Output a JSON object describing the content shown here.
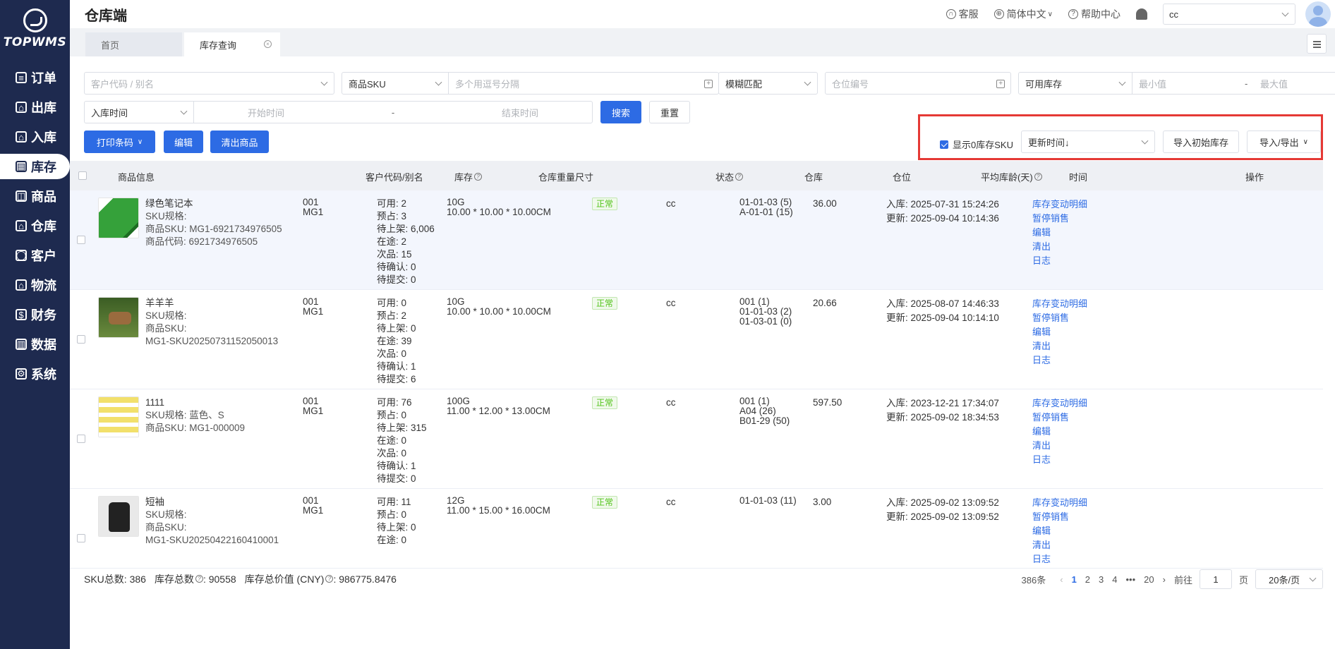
{
  "app": {
    "logo_text": "TOPWMS",
    "title": "仓库端"
  },
  "sidebar": {
    "items": [
      {
        "label": "订单",
        "icon": "list-icon"
      },
      {
        "label": "出库",
        "icon": "home-icon"
      },
      {
        "label": "入库",
        "icon": "home-icon"
      },
      {
        "label": "库存",
        "icon": "inventory-icon"
      },
      {
        "label": "商品",
        "icon": "bag-icon"
      },
      {
        "label": "仓库",
        "icon": "home-icon"
      },
      {
        "label": "客户",
        "icon": "user-icon"
      },
      {
        "label": "物流",
        "icon": "home-icon"
      },
      {
        "label": "财务",
        "icon": "finance-icon"
      },
      {
        "label": "数据",
        "icon": "chart-icon"
      },
      {
        "label": "系统",
        "icon": "gear-icon"
      }
    ]
  },
  "header": {
    "service": "客服",
    "language": "简体中文",
    "help": "帮助中心",
    "warehouse_value": "cc"
  },
  "tabs": [
    {
      "label": "首页"
    },
    {
      "label": "库存查询"
    }
  ],
  "filters": {
    "customer_placeholder": "客户代码 / 别名",
    "sku_type": "商品SKU",
    "sku_placeholder": "多个用逗号分隔",
    "match_mode": "模糊匹配",
    "location_placeholder": "仓位编号",
    "stock_type": "可用库存",
    "min_placeholder": "最小值",
    "range_sep": "-",
    "max_placeholder": "最大值",
    "time_type": "入库时间",
    "start_placeholder": "开始时间",
    "end_placeholder": "结束时间",
    "search_btn": "搜索",
    "reset_btn": "重置"
  },
  "toolbar": {
    "print_btn": "打印条码",
    "edit_btn": "编辑",
    "clear_btn": "清出商品",
    "show_zero_label": "显示0库存SKU",
    "sort_value": "更新时间↓",
    "import_btn": "导入初始库存",
    "import_export_btn": "导入/导出"
  },
  "table": {
    "headers": {
      "product": "商品信息",
      "customer": "客户代码/别名",
      "stock": "库存",
      "weight": "仓库重量尺寸",
      "status": "状态",
      "warehouse": "仓库",
      "location": "仓位",
      "age": "平均库龄(天)",
      "time": "时间",
      "action": "操作"
    },
    "actions": [
      "库存变动明细",
      "暂停销售",
      "编辑",
      "清出",
      "日志"
    ],
    "rows": [
      {
        "name": "绿色笔记本",
        "info": [
          "SKU规格:",
          "商品SKU:  MG1-6921734976505",
          "商品代码:  6921734976505"
        ],
        "customer": [
          "001",
          "MG1"
        ],
        "stock": [
          "可用:  2",
          "预占:  3",
          "待上架:  6,006",
          "在途:  2",
          "次品:  15",
          "待确认:  0",
          "待提交:  0"
        ],
        "weight": [
          "10G",
          "10.00 * 10.00 * 10.00CM"
        ],
        "status": "正常",
        "warehouse": "cc",
        "locations": [
          "01-01-03 (5)",
          "A-01-01 (15)"
        ],
        "age": "36.00",
        "in_time": "入库:  2025-07-31 15:24:26",
        "up_time": "更新:  2025-09-04 10:14:36"
      },
      {
        "name": "羊羊羊",
        "info": [
          "SKU规格:",
          "商品SKU:",
          "MG1-SKU20250731152050013"
        ],
        "customer": [
          "001",
          "MG1"
        ],
        "stock": [
          "可用:  0",
          "预占:  2",
          "待上架:  0",
          "在途:  39",
          "次品:  0",
          "待确认:  1",
          "待提交:  6"
        ],
        "weight": [
          "10G",
          "10.00 * 10.00 * 10.00CM"
        ],
        "status": "正常",
        "warehouse": "cc",
        "locations": [
          "001 (1)",
          "01-01-03 (2)",
          "01-03-01 (0)"
        ],
        "age": "20.66",
        "in_time": "入库:  2025-08-07 14:46:33",
        "up_time": "更新:  2025-09-04 10:14:10"
      },
      {
        "name": "1111",
        "info": [
          "SKU规格:  蓝色、S",
          "商品SKU:  MG1-000009"
        ],
        "customer": [
          "001",
          "MG1"
        ],
        "stock": [
          "可用:  76",
          "预占:  0",
          "待上架:  315",
          "在途:  0",
          "次品:  0",
          "待确认:  1",
          "待提交:  0"
        ],
        "weight": [
          "100G",
          "11.00 * 12.00 * 13.00CM"
        ],
        "status": "正常",
        "warehouse": "cc",
        "locations": [
          "001 (1)",
          "A04 (26)",
          "B01-29 (50)"
        ],
        "age": "597.50",
        "in_time": "入库:  2023-12-21 17:34:07",
        "up_time": "更新:  2025-09-02 18:34:53"
      },
      {
        "name": "短袖",
        "info": [
          "SKU规格:",
          "商品SKU:",
          "MG1-SKU20250422160410001"
        ],
        "customer": [
          "001",
          "MG1"
        ],
        "stock": [
          "可用:  11",
          "预占:  0",
          "待上架:  0",
          "在途:  0"
        ],
        "weight": [
          "12G",
          "11.00 * 15.00 * 16.00CM"
        ],
        "status": "正常",
        "warehouse": "cc",
        "locations": [
          "01-01-03 (11)"
        ],
        "age": "3.00",
        "in_time": "入库:  2025-09-02 13:09:52",
        "up_time": "更新:  2025-09-02 13:09:52"
      }
    ]
  },
  "footer": {
    "sku_total": "SKU总数:  386",
    "stock_total_label": "库存总数",
    "stock_total_value": ":  90558",
    "value_label": "库存总价值 (CNY)",
    "value_value": ":  986775.8476"
  },
  "pagination": {
    "total": "386条",
    "pages": [
      "1",
      "2",
      "3",
      "4",
      "•••",
      "20"
    ],
    "goto_label": "前往",
    "goto_value": "1",
    "page_suffix": "页",
    "page_size": "20条/页"
  }
}
